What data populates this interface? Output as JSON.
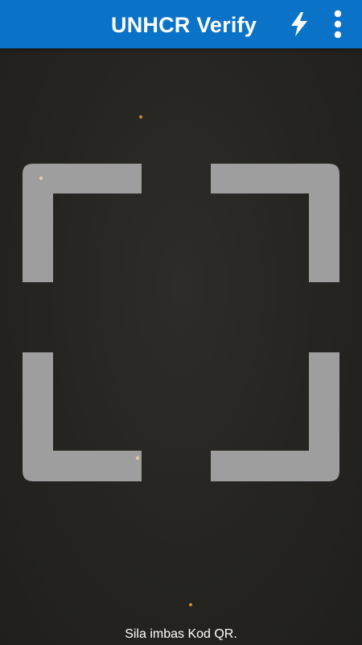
{
  "toolbar": {
    "title": "UNHCR Verify",
    "background_color": "#0a73c7",
    "flash_icon": "flash-icon",
    "menu_icon": "more-vertical-icon"
  },
  "scanner": {
    "frame_color": "#9e9e9e",
    "hint_text": "Sila imbas Kod QR."
  }
}
